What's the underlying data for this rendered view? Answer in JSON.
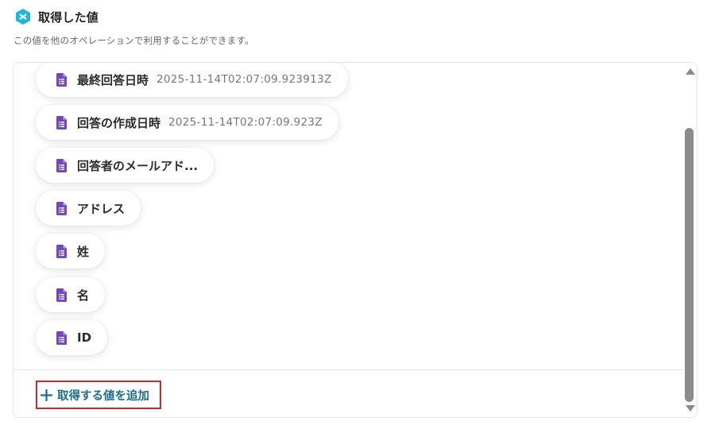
{
  "header": {
    "title": "取得した値",
    "subtitle": "この値を他のオペレーションで利用することができます。",
    "icon": "yoom-app-icon",
    "icon_color": "#1fb6d8"
  },
  "values": [
    {
      "label": "最終回答日時",
      "value": "2025-11-14T02:07:09.923913Z",
      "icon": "google-forms-doc-icon"
    },
    {
      "label": "回答の作成日時",
      "value": "2025-11-14T02:07:09.923Z",
      "icon": "google-forms-doc-icon"
    },
    {
      "label": "回答者のメールアド...",
      "value": "",
      "icon": "google-forms-doc-icon"
    },
    {
      "label": "アドレス",
      "value": "",
      "icon": "google-forms-doc-icon"
    },
    {
      "label": "姓",
      "value": "",
      "icon": "google-forms-doc-icon"
    },
    {
      "label": "名",
      "value": "",
      "icon": "google-forms-doc-icon"
    },
    {
      "label": "ID",
      "value": "",
      "icon": "google-forms-doc-icon"
    }
  ],
  "add_button": {
    "label": "取得する値を追加",
    "color": "#1f6b86",
    "highlight_color": "#d3262e"
  },
  "colors": {
    "forms_purple": "#7248b9",
    "scroll_thumb": "#8c8c8c"
  }
}
